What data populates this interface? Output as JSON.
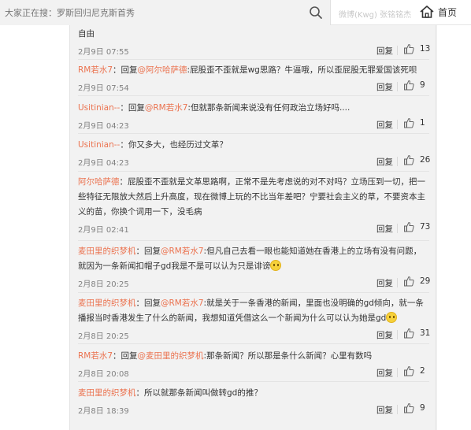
{
  "search": {
    "placeholder": "大家正在搜：罗斯回归尼克斯首秀"
  },
  "header": {
    "faded_text": "微博(Kwg) 张铭铭杰",
    "home_label": "首页"
  },
  "colors": {
    "username": "#eb7350",
    "time": "#808080",
    "divider": "#e4e4e4"
  },
  "comments": [
    {
      "text": "自由",
      "time": "2月9日 07:55",
      "reply": "回复",
      "likes": "13"
    },
    {
      "user": "RM若水7",
      "prefix": "：回复",
      "target": "@阿尔哈萨德",
      "text": ":屁股歪不歪就是wg思路？牛逼哦，所以歪屁股无罪爱国该死呗",
      "time": "2月9日 07:54",
      "reply": "回复",
      "likes": "9"
    },
    {
      "user": "Usitinian--",
      "prefix": "：回复",
      "target": "@RM若水7",
      "text": ":但就那条新闻来说没有任何政治立场好吗....",
      "time": "2月9日 04:23",
      "reply": "回复",
      "likes": "1"
    },
    {
      "user": "Usitinian--",
      "text": "：你又多大，也经历过文革？",
      "time": "2月9日 04:23",
      "reply": "回复",
      "likes": "26"
    },
    {
      "user": "阿尔哈萨德",
      "text": "：屁股歪不歪就是文革思路啊，正常不是先考虑说的对不对吗？立场压到一切，把一些特征无限放大然后上升高度，现在微博上玩的不比当年差吧？宁要社会主义的草，不要资本主义的苗，你换个词用一下，没毛病",
      "time": "2月9日 02:41",
      "reply": "回复",
      "likes": "73"
    },
    {
      "user": "麦田里的织梦机",
      "prefix": "：回复",
      "target": "@RM若水7",
      "text": ":但凡自己去看一眼也能知道她在香港上的立场有没有问题，就因为一条新闻扣帽子gd我是不是可以认为只是诽谤",
      "time": "2月8日 20:25",
      "reply": "回复",
      "likes": "29"
    },
    {
      "user": "麦田里的织梦机",
      "prefix": "：回复",
      "target": "@RM若水7",
      "text": ":就是关于一条香港的新闻，里面也没明确的gd倾向，就一条播报当时香港发生了什么的新闻，我想知道凭借这么一个新闻为什么可以认为她是gd",
      "time": "2月8日 20:25",
      "reply": "回复",
      "likes": "31"
    },
    {
      "user": "RM若水7",
      "prefix": "：回复",
      "target": "@麦田里的织梦机",
      "text": ":那条新闻？所以那是条什么新闻？心里有数吗",
      "time": "2月8日 20:08",
      "reply": "回复",
      "likes": "2"
    },
    {
      "user": "麦田里的织梦机",
      "text": "：所以就那条新闻叫做转gd的推？",
      "time": "2月8日 18:39",
      "reply": "回复",
      "likes": "9"
    }
  ]
}
